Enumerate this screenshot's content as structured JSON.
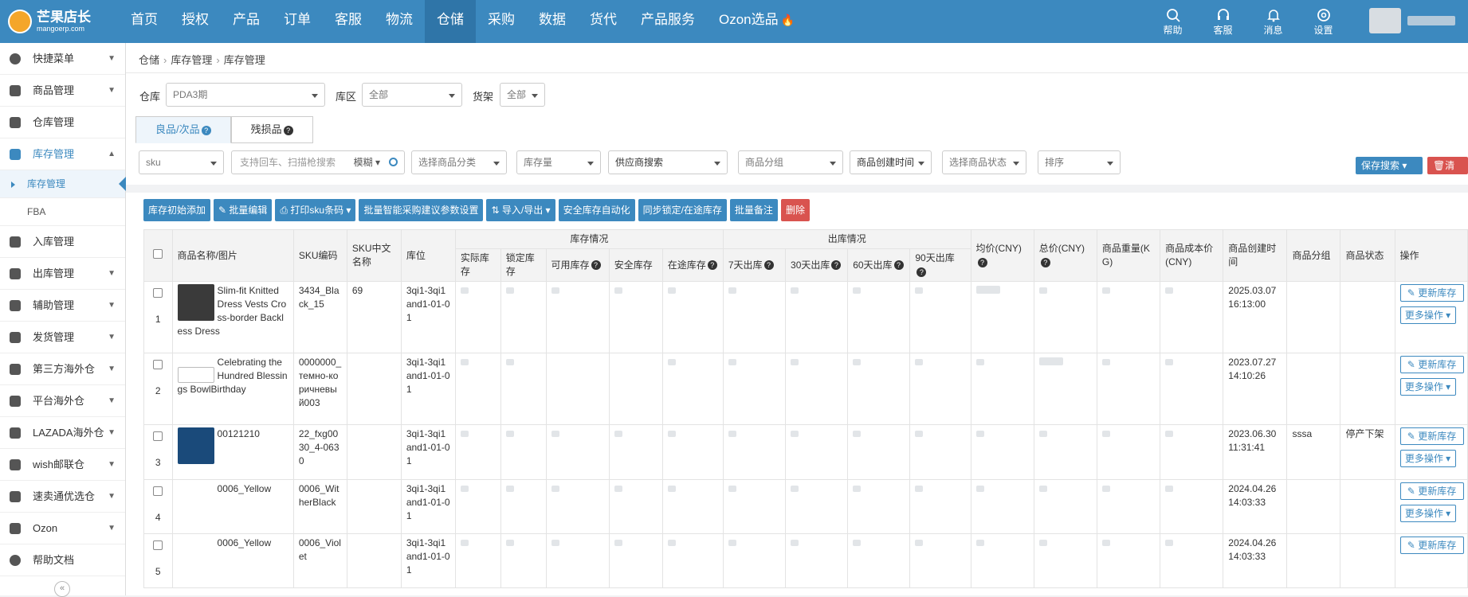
{
  "brand": {
    "name": "芒果店长",
    "domain": "mangoerp.com"
  },
  "nav": [
    "首页",
    "授权",
    "产品",
    "订单",
    "客服",
    "物流",
    "仓储",
    "采购",
    "数据",
    "货代",
    "产品服务",
    "Ozon选品"
  ],
  "nav_active_index": 6,
  "top_icons": [
    {
      "label": "帮助",
      "icon": "search-icon"
    },
    {
      "label": "客服",
      "icon": "headset-icon"
    },
    {
      "label": "消息",
      "icon": "bell-icon"
    },
    {
      "label": "设置",
      "icon": "gear-icon"
    }
  ],
  "sidebar": {
    "items": [
      "快捷菜单",
      "商品管理",
      "仓库管理",
      "库存管理"
    ],
    "sub": [
      "库存管理",
      "FBA"
    ],
    "items2": [
      "入库管理",
      "出库管理",
      "辅助管理",
      "发货管理",
      "第三方海外仓",
      "平台海外仓",
      "LAZADA海外仓",
      "wish邮联仓",
      "速卖通优选仓",
      "Ozon",
      "帮助文档"
    ]
  },
  "breadcrumb": [
    "仓储",
    "库存管理",
    "库存管理"
  ],
  "filters": {
    "warehouse_label": "仓库",
    "warehouse_value": "PDA3期",
    "zone_label": "库区",
    "zone_value": "全部",
    "shelf_label": "货架",
    "shelf_value": "全部"
  },
  "tabs": [
    "良品/次品",
    "残损品"
  ],
  "search": {
    "sku": "sku",
    "placeholder": "支持回车、扫描枪搜索",
    "mode": "模糊",
    "category": "选择商品分类",
    "stock": "库存量",
    "supplier": "供应商搜索",
    "group": "商品分组",
    "created": "商品创建时间",
    "status": "选择商品状态",
    "sort": "排序",
    "save": "保存搜索",
    "clear": "清空"
  },
  "toolbar": [
    "库存初始添加",
    "批量编辑",
    "打印sku条码",
    "批量智能采购建议参数设置",
    "导入/导出",
    "安全库存自动化",
    "同步锁定/在途库存",
    "批量备注",
    "删除"
  ],
  "table": {
    "headers": {
      "name": "商品名称/图片",
      "sku": "SKU编码",
      "cn": "SKU中文名称",
      "loc": "库位",
      "stock_group": "库存情况",
      "out_group": "出库情况",
      "avg": "均价(CNY)",
      "total": "总价(CNY)",
      "weight": "商品重量(KG)",
      "cost": "商品成本价(CNY)",
      "created": "商品创建时间",
      "group": "商品分组",
      "status": "商品状态",
      "ops": "操作"
    },
    "stock_sub": [
      "实际库存",
      "锁定库存",
      "可用库存",
      "安全库存",
      "在途库存"
    ],
    "out_sub": [
      "7天出库",
      "30天出库",
      "60天出库",
      "90天出库"
    ],
    "rows": [
      {
        "no": "1",
        "name": "Slim-fit Knitted Dress Vests Cross-border Backless Dress",
        "sku": "3434_Black_15",
        "cn": "69",
        "loc": "3qi1-3qi1and1-01-01",
        "created": "2025.03.07 16:13:00",
        "group": "",
        "status": ""
      },
      {
        "no": "2",
        "name": "Celebrating the Hundred Blessings BowlBirthday",
        "sku": "0000000_темно-коричневый003",
        "cn": "",
        "loc": "3qi1-3qi1and1-01-01",
        "created": "2023.07.27 14:10:26",
        "group": "",
        "status": ""
      },
      {
        "no": "3",
        "name": "00121210",
        "sku": "22_fxg0030_4-0630",
        "cn": "",
        "loc": "3qi1-3qi1and1-01-01",
        "created": "2023.06.30 11:31:41",
        "group": "sssa",
        "status": "停产下架"
      },
      {
        "no": "4",
        "name": "0006_Yellow",
        "sku": "0006_WitherBlack",
        "cn": "",
        "loc": "3qi1-3qi1and1-01-01",
        "created": "2024.04.26 14:03:33",
        "group": "",
        "status": ""
      },
      {
        "no": "5",
        "name": "0006_Yellow",
        "sku": "0006_Violet",
        "cn": "",
        "loc": "3qi1-3qi1and1-01-01",
        "created": "2024.04.26 14:03:33",
        "group": "",
        "status": ""
      }
    ],
    "op_update": "更新库存",
    "op_more": "更多操作"
  },
  "colors": {
    "primary": "#3c89bf",
    "danger": "#d9534f",
    "nav_active": "#2f75a8"
  }
}
